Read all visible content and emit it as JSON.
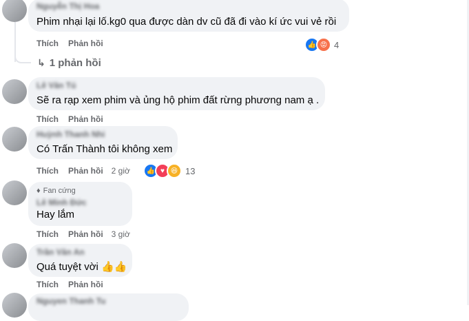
{
  "comments": [
    {
      "author": "Nguyễn Thị Hoa",
      "text": "Phim nhại lại lố.kg0 qua được dàn dv cũ đã đi vào kí ức vui vẻ rồi",
      "like_label": "Thích",
      "reply_label": "Phản hồi",
      "time": "",
      "reaction_count": "4",
      "reactions": [
        "like-icon",
        "angry-icon"
      ],
      "replies_link": "1 phản hồi"
    },
    {
      "author": "Lê Văn Tú",
      "text": "Sẽ ra rạp xem phim và ủng hộ phim đất rừng phương nam ạ .",
      "like_label": "Thích",
      "reply_label": "Phản hồi"
    },
    {
      "author": "Huỳnh Thanh Nhi",
      "text": "Có Trấn Thành tôi không xem",
      "like_label": "Thích",
      "reply_label": "Phản hồi",
      "time": "2 giờ",
      "reaction_count": "13",
      "reactions": [
        "like-icon",
        "love-icon",
        "haha-icon"
      ]
    },
    {
      "badge": "Fan cứng",
      "author": "Lê Minh Đức",
      "text": "Hay lắm",
      "like_label": "Thích",
      "reply_label": "Phản hồi",
      "time": "3 giờ"
    },
    {
      "author": "Trần Văn An",
      "text": "Quá tuyệt vời 👍👍",
      "like_label": "Thích",
      "reply_label": "Phản hồi"
    },
    {
      "author": "Nguyen Thanh Tu"
    }
  ],
  "colors": {
    "bubble": "#f0f2f5",
    "secondary_text": "#65676b",
    "like": "#1877f2",
    "angry": "#f7714b",
    "love": "#f33e58",
    "haha": "#f7b125"
  }
}
